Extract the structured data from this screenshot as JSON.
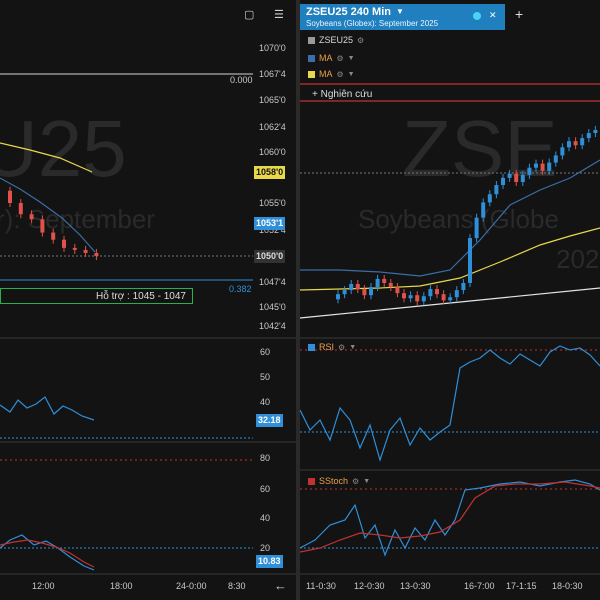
{
  "colors": {
    "up": "#2f8fd8",
    "down": "#e0524b",
    "ma1": "#3a6ea8",
    "ma2": "#e8d84b",
    "rsi": "#2f8fd8",
    "stoch_k": "#2f8fd8",
    "stoch_d": "#c23232",
    "accent": "#1f7fbf"
  },
  "left": {
    "toolbar": {
      "window_icon": "window-icon",
      "menu_icon": "menu-icon"
    },
    "watermark": "U25",
    "watermark_sub": "r): September",
    "price_ticks": [
      "1070'0",
      "1067'4",
      "1065'0",
      "1062'4",
      "1060'0",
      "1055'0",
      "1052'4",
      "1047'4",
      "1045'0",
      "1042'4"
    ],
    "tags": {
      "yellow": "1058'0",
      "blue": "1053'1",
      "dark": "1050'0"
    },
    "line_labels": {
      "top": "0.000",
      "bottom": "0.382"
    },
    "support_box": "Hỗ trợ : 1045 - 1047",
    "rsi_ticks": [
      "60",
      "50",
      "40"
    ],
    "rsi_value": "32.18",
    "stoch_ticks": [
      "80",
      "60",
      "40",
      "20"
    ],
    "stoch_value": "10.83",
    "time_ticks": [
      "12:00",
      "18:00",
      "24-0:00",
      "8:30"
    ],
    "back_arrow": "←",
    "chart_data": {
      "type": "line",
      "series": [
        {
          "name": "",
          "values": [
            1055.0,
            1053.9,
            1053.4,
            1052.1,
            1051.4,
            1050.6,
            1050.4,
            1050.1,
            1049.8
          ]
        }
      ]
    }
  },
  "right": {
    "header": {
      "title": "ZSEU25 240 Min",
      "subtitle": "Soybeans (Globex): September 2025",
      "dropdown_icon": "chevron-down-icon",
      "dot_icon": "status-dot-icon",
      "close": "✕",
      "add": "+"
    },
    "legend": [
      {
        "label": "ZSEU25",
        "color": "#9a9a9a"
      },
      {
        "label": "MA",
        "color": "#3a6ea8"
      },
      {
        "label": "MA",
        "color": "#e8d84b"
      }
    ],
    "research": "Nghiên cứu",
    "watermark": "ZSE",
    "watermark_sub": "Soybeans (Globe",
    "watermark_year": "202",
    "rsi_label": "RSI",
    "stoch_label": "SStoch",
    "time_ticks": [
      "11-0:30",
      "12-0:30",
      "13-0:30",
      "16-7:00",
      "17-1:15",
      "18-0:30"
    ],
    "chart_data": {
      "type": "line",
      "series": [
        {
          "name": "",
          "values": [
            1046.5,
            1046.9,
            1047.5,
            1047.0,
            1046.4,
            1047.2,
            1048.0,
            1047.6,
            1047.2,
            1046.6,
            1046.1,
            1046.4,
            1045.8,
            1046.3,
            1047.0,
            1046.5,
            1045.9,
            1046.2,
            1046.9,
            1047.6,
            1052.0,
            1054.0,
            1055.5,
            1056.3,
            1057.2,
            1057.9,
            1058.3,
            1057.5,
            1058.2,
            1058.9,
            1059.3,
            1058.6,
            1059.4,
            1060.1,
            1060.9,
            1061.5,
            1061.1,
            1061.8,
            1062.3,
            1062.6,
            1062.0,
            1062.4
          ]
        }
      ]
    }
  }
}
